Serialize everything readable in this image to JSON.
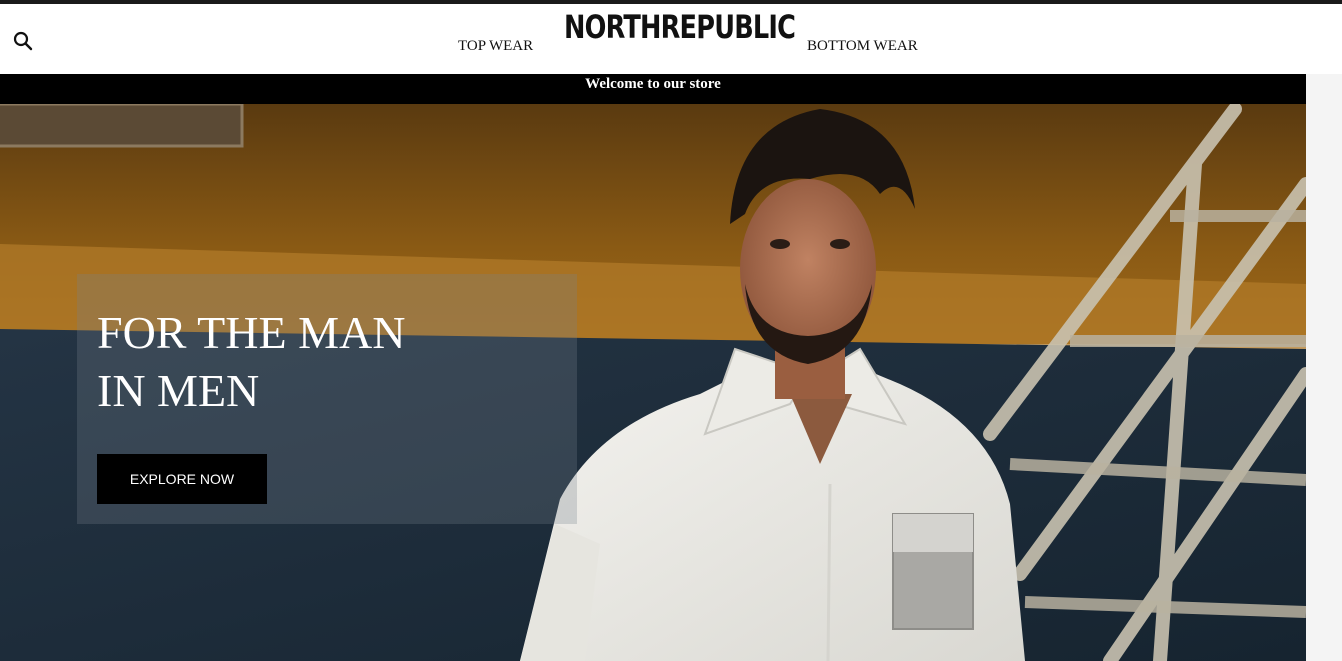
{
  "header": {
    "brand": "NORTHREPUBLIC",
    "search_icon": "search-icon",
    "nav": [
      {
        "label": "TOP WEAR"
      },
      {
        "label": "BOTTOM WEAR"
      }
    ]
  },
  "announcement": {
    "text": "Welcome to our store"
  },
  "hero": {
    "headline_line1": "FOR THE MAN",
    "headline_line2": "IN MEN",
    "cta_label": "EXPLORE NOW"
  },
  "colors": {
    "accent": "#000000",
    "text_on_dark": "#ffffff"
  }
}
